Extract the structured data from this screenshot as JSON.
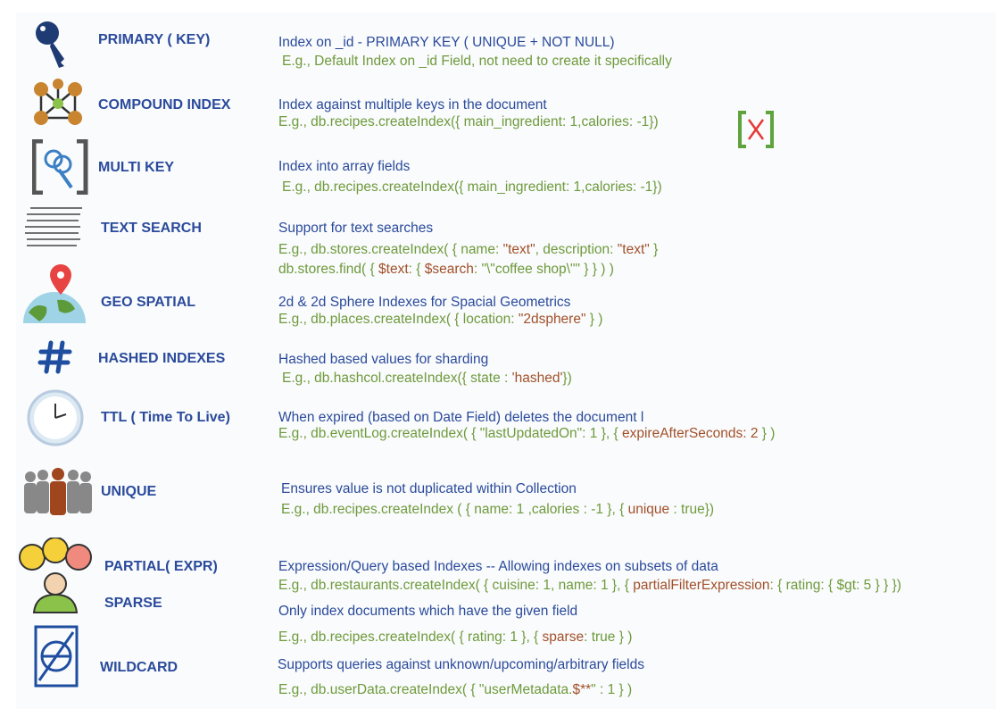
{
  "colors": {
    "label": "#2b4a9b",
    "description": "#2b4a9b",
    "code": "#6f9a3c",
    "highlight": "#a2502a"
  },
  "rows": [
    {
      "icon": "key-icon",
      "label": "PRIMARY ( KEY)",
      "lines": [
        {
          "type": "desc",
          "segs": [
            {
              "t": "Index on _id  - PRIMARY KEY ( UNIQUE + NOT NULL)"
            }
          ]
        },
        {
          "type": "code",
          "segs": [
            {
              "t": "E.g., Default Index on _id Field, not need to create it specifically"
            }
          ]
        }
      ]
    },
    {
      "icon": "molecule-network-icon",
      "label": "COMPOUND INDEX",
      "lines": [
        {
          "type": "desc",
          "segs": [
            {
              "t": "Index against multiple keys in the document"
            }
          ]
        },
        {
          "type": "code",
          "segs": [
            {
              "t": "E.g., db.recipes.createIndex({ main_ingredient: 1,calories: -1})"
            }
          ]
        }
      ]
    },
    {
      "icon": "array-keys-icon",
      "label": "MULTI KEY",
      "lines": [
        {
          "type": "desc",
          "segs": [
            {
              "t": "Index into array fields"
            }
          ]
        },
        {
          "type": "code",
          "segs": [
            {
              "t": "E.g., db.recipes.createIndex({ main_ingredient: 1,calories: -1})"
            }
          ]
        }
      ]
    },
    {
      "icon": "text-document-icon",
      "label": "TEXT SEARCH",
      "lines": [
        {
          "type": "desc",
          "segs": [
            {
              "t": "Support for text searches"
            }
          ]
        },
        {
          "type": "code",
          "segs": [
            {
              "t": "E.g., db.stores.createIndex( { name: "
            },
            {
              "t": "\"text\"",
              "hl": true
            },
            {
              "t": ", description: "
            },
            {
              "t": "\"text\"",
              "hl": true
            },
            {
              "t": " }"
            }
          ]
        },
        {
          "type": "code",
          "segs": [
            {
              "t": "db.stores.find( { "
            },
            {
              "t": "$text",
              "hl": true
            },
            {
              "t": ": { "
            },
            {
              "t": "$search",
              "hl": true
            },
            {
              "t": ": \"\\\"coffee shop\\\"\" } } ) )"
            }
          ]
        }
      ]
    },
    {
      "icon": "globe-pin-icon",
      "label": "GEO SPATIAL",
      "lines": [
        {
          "type": "desc",
          "segs": [
            {
              "t": "2d & 2d Sphere Indexes for Spacial Geometrics"
            }
          ]
        },
        {
          "type": "code",
          "segs": [
            {
              "t": "E.g., db.places.createIndex( { location: "
            },
            {
              "t": "\"2dsphere\"",
              "hl": true
            },
            {
              "t": " } )"
            }
          ]
        }
      ]
    },
    {
      "icon": "hash-icon",
      "label": "HASHED  INDEXES",
      "lines": [
        {
          "type": "desc",
          "segs": [
            {
              "t": "Hashed based values for sharding"
            }
          ]
        },
        {
          "type": "code",
          "segs": [
            {
              "t": "E.g., db.hashcol.createIndex({ state : "
            },
            {
              "t": "'hashed'",
              "hl": true
            },
            {
              "t": "})"
            }
          ]
        }
      ]
    },
    {
      "icon": "clock-icon",
      "label": "TTL ( Time To Live)",
      "lines": [
        {
          "type": "desc",
          "segs": [
            {
              "t": "When expired (based on Date Field) deletes the document l"
            }
          ]
        },
        {
          "type": "code",
          "segs": [
            {
              "t": "E.g., db.eventLog.createIndex( { \"lastUpdatedOn\": 1 }, { "
            },
            {
              "t": "expireAfterSeconds: 2",
              "hl": true
            },
            {
              "t": " } )"
            }
          ]
        }
      ]
    },
    {
      "icon": "people-group-icon",
      "label": "UNIQUE",
      "lines": [
        {
          "type": "desc",
          "segs": [
            {
              "t": "Ensures value is not duplicated within Collection"
            }
          ]
        },
        {
          "type": "code",
          "segs": [
            {
              "t": "E.g., db.recipes.createIndex (  { name: 1 ,calories : -1 },  { "
            },
            {
              "t": "unique",
              "hl": true
            },
            {
              "t": " : true})"
            }
          ]
        }
      ]
    },
    {
      "icon": "emoji-faces-person-icon",
      "label": "PARTIAL( EXPR)",
      "lines": [
        {
          "type": "desc",
          "segs": [
            {
              "t": "Expression/Query based Indexes -- Allowing indexes on subsets of data"
            }
          ]
        },
        {
          "type": "code",
          "segs": [
            {
              "t": "E.g., db.restaurants.createIndex(   { cuisine: 1, name: 1 },   { "
            },
            {
              "t": "partialFilterExpression",
              "hl": true
            },
            {
              "t": ": { rating: { $gt: 5 } } })"
            }
          ]
        }
      ]
    },
    {
      "icon": "",
      "label": "SPARSE",
      "lines": [
        {
          "type": "desc",
          "segs": [
            {
              "t": "Only index documents which have the given field"
            }
          ]
        },
        {
          "type": "code",
          "segs": [
            {
              "t": "E.g., db.recipes.createIndex( { rating: 1 }, { "
            },
            {
              "t": "sparse",
              "hl": true
            },
            {
              "t": ": true } )"
            }
          ]
        }
      ]
    },
    {
      "icon": "wildcard-icon",
      "label": "WILDCARD",
      "lines": [
        {
          "type": "desc",
          "segs": [
            {
              "t": "Supports queries against unknown/upcoming/arbitrary fields"
            }
          ]
        },
        {
          "type": "code",
          "segs": [
            {
              "t": "E.g., db.userData.createIndex( { \"userMetadata."
            },
            {
              "t": "$**",
              "hl": true
            },
            {
              "t": "\" : 1 } )"
            }
          ]
        }
      ]
    }
  ],
  "annotation_icon": "bracket-x-icon"
}
